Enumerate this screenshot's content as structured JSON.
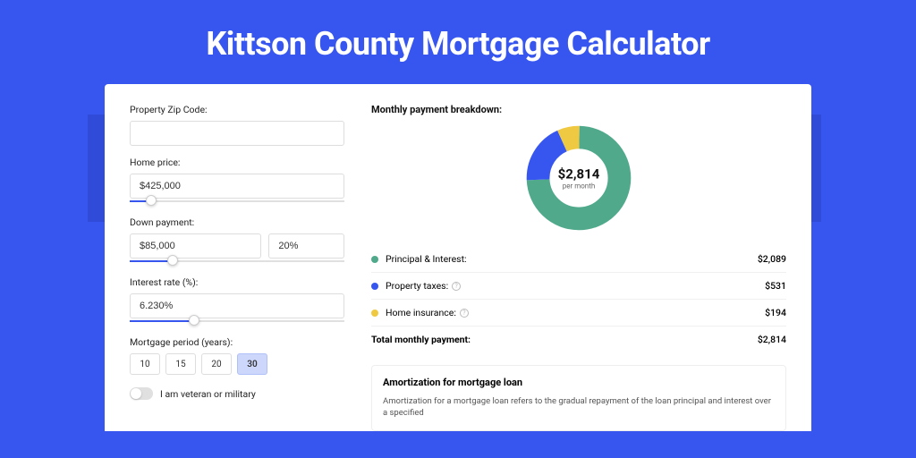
{
  "page_title": "Kittson County Mortgage Calculator",
  "form": {
    "zip_label": "Property Zip Code:",
    "zip_value": "",
    "home_price_label": "Home price:",
    "home_price_value": "$425,000",
    "home_price_slider_pct": 10,
    "down_payment_label": "Down payment:",
    "down_payment_value": "$85,000",
    "down_payment_pct_value": "20%",
    "down_payment_slider_pct": 20,
    "interest_label": "Interest rate (%):",
    "interest_value": "6.230%",
    "interest_slider_pct": 30,
    "period_label": "Mortgage period (years):",
    "periods": [
      "10",
      "15",
      "20",
      "30"
    ],
    "period_selected": "30",
    "veteran_label": "I am veteran or military"
  },
  "breakdown": {
    "title": "Monthly payment breakdown:",
    "center_amount": "$2,814",
    "center_sub": "per month",
    "items": [
      {
        "label": "Principal & Interest:",
        "value": "$2,089",
        "color": "#4fa98a",
        "has_info": false
      },
      {
        "label": "Property taxes:",
        "value": "$531",
        "color": "#3756f0",
        "has_info": true
      },
      {
        "label": "Home insurance:",
        "value": "$194",
        "color": "#f0c942",
        "has_info": true
      }
    ],
    "total_label": "Total monthly payment:",
    "total_value": "$2,814"
  },
  "chart_data": {
    "type": "pie",
    "title": "Monthly payment breakdown",
    "series": [
      {
        "name": "Principal & Interest",
        "value": 2089,
        "color": "#4fa98a"
      },
      {
        "name": "Property taxes",
        "value": 531,
        "color": "#3756f0"
      },
      {
        "name": "Home insurance",
        "value": 194,
        "color": "#f0c942"
      }
    ],
    "total": 2814,
    "center_label": "$2,814 per month"
  },
  "amortization": {
    "title": "Amortization for mortgage loan",
    "text": "Amortization for a mortgage loan refers to the gradual repayment of the loan principal and interest over a specified"
  }
}
